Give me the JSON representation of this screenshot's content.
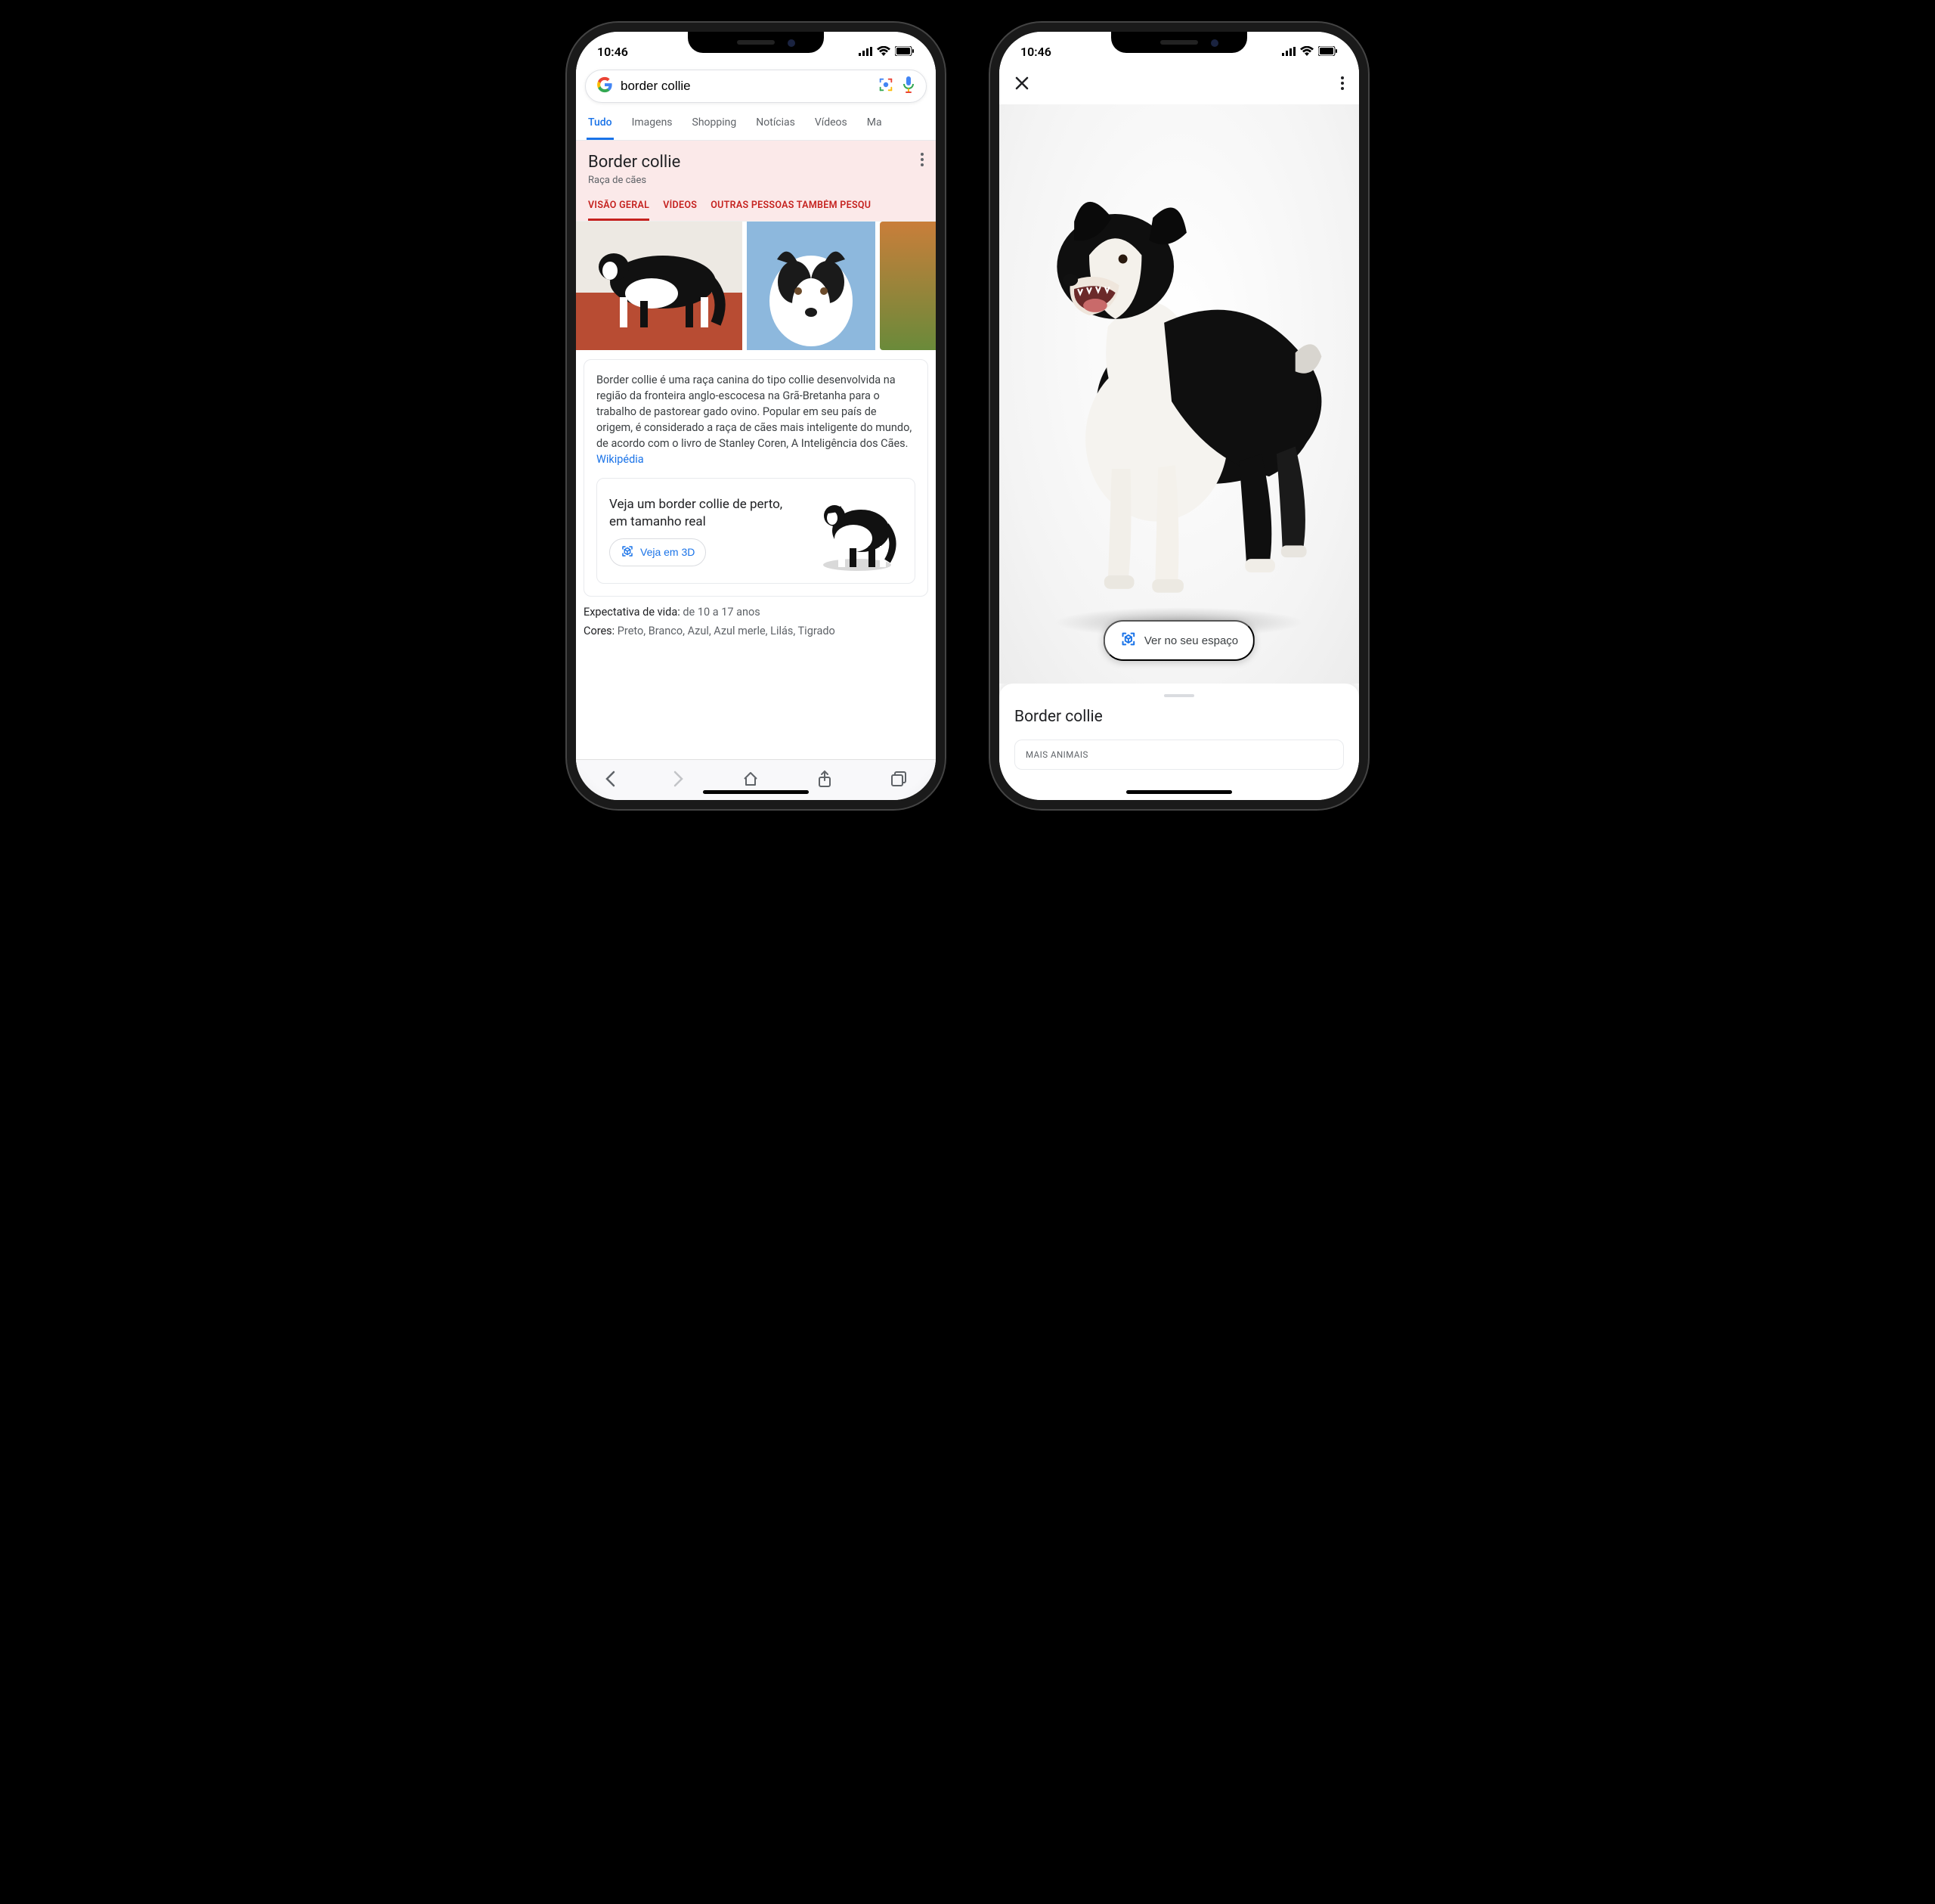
{
  "status": {
    "time": "10:46"
  },
  "phone1": {
    "search": {
      "query": "border collie"
    },
    "nav_tabs": [
      "Tudo",
      "Imagens",
      "Shopping",
      "Notícias",
      "Vídeos",
      "Ma"
    ],
    "kp": {
      "title": "Border collie",
      "subtitle": "Raça de cães",
      "tabs": [
        "VISÃO GERAL",
        "VÍDEOS",
        "OUTRAS PESSOAS TAMBÉM PESQU"
      ]
    },
    "description": "Border collie é uma raça canina do tipo collie desenvolvida na região da fronteira anglo-escocesa na Grã-Bretanha para o trabalho de pastorear gado ovino. Popular em seu país de origem, é considerado a raça de cães mais inteligente do mundo, de acordo com o livro de Stanley Coren, A Inteligência dos Cães. ",
    "source_link": "Wikipédia",
    "ar_prompt": "Veja um border collie de perto, em tamanho real",
    "ar_button": "Veja em 3D",
    "facts": {
      "life_label": "Expectativa de vida:",
      "life_value": "de 10 a 17 anos",
      "colors_label": "Cores:",
      "colors_value": "Preto, Branco, Azul, Azul merle, Lilás, Tigrado"
    }
  },
  "phone2": {
    "ar_space_button": "Ver no seu espaço",
    "sheet_title": "Border collie",
    "sheet_sub": "MAIS ANIMAIS"
  },
  "icons": {
    "google_g": "G",
    "lens": "lens-icon",
    "mic": "mic-icon",
    "more": "more-icon",
    "close": "close-icon",
    "cube": "cube-3d-icon"
  }
}
